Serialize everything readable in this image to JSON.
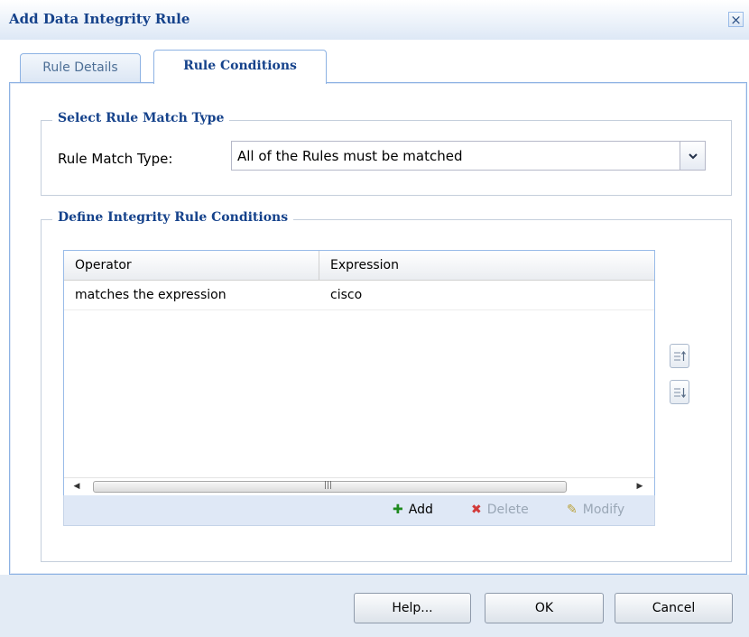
{
  "dialog": {
    "title": "Add Data Integrity Rule",
    "close_icon": "×"
  },
  "tabs": [
    {
      "label": "Rule Details",
      "active": false
    },
    {
      "label": "Rule Conditions",
      "active": true
    }
  ],
  "match_section": {
    "legend": "Select Rule Match Type",
    "label": "Rule Match Type:",
    "selected_value": "All of the Rules must be matched",
    "trigger_icon": "chevron-down-icon"
  },
  "conditions_section": {
    "legend": "Define Integrity Rule Conditions",
    "grid": {
      "columns": [
        "Operator",
        "Expression"
      ],
      "rows": [
        {
          "operator": "matches the expression",
          "expression": "cisco"
        }
      ]
    },
    "toolbar": {
      "add_label": "Add",
      "delete_label": "Delete",
      "modify_label": "Modify",
      "delete_enabled": false,
      "modify_enabled": false
    },
    "move_buttons": [
      "move-up-icon",
      "move-down-icon"
    ]
  },
  "footer": {
    "help_label": "Help...",
    "ok_label": "OK",
    "cancel_label": "Cancel"
  },
  "colors": {
    "title_text": "#15428b",
    "tab_border": "#8db2e3",
    "footer_bg": "#e3ebf5",
    "add_icon": "#1e8a1e",
    "delete_icon": "#d23a3a"
  }
}
